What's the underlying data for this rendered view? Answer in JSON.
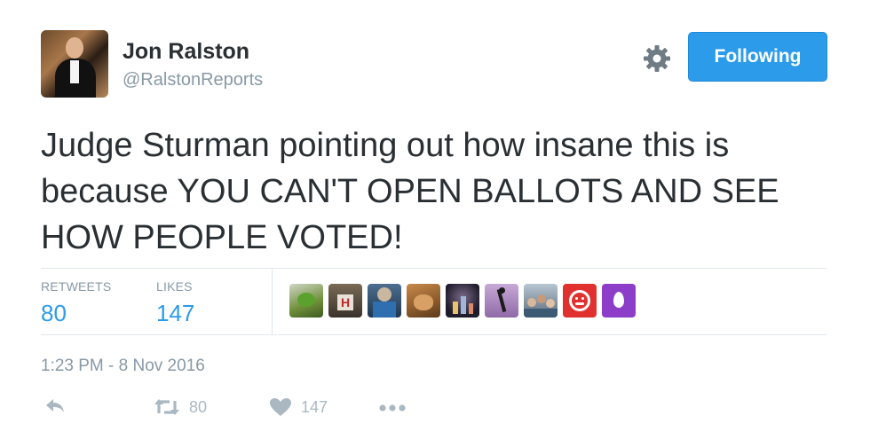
{
  "author": {
    "name": "Jon Ralston",
    "handle": "@RalstonReports"
  },
  "follow_button": {
    "label": "Following",
    "color": "#2b9bea"
  },
  "tweet": {
    "text": "Judge Sturman pointing out how insane this is because YOU CAN'T OPEN BALLOTS AND SEE HOW PEOPLE VOTED!",
    "timestamp": "1:23 PM - 8 Nov 2016"
  },
  "stats": {
    "retweets_label": "RETWEETS",
    "retweets_value": "80",
    "likes_label": "LIKES",
    "likes_value": "147"
  },
  "liker_avatars": [
    "frog-avatar",
    "letter-h-avatar",
    "football-player-avatar",
    "dog-avatar",
    "city-night-avatar",
    "dancer-avatar",
    "group-photo-avatar",
    "red-face-avatar",
    "purple-egg-avatar"
  ],
  "actions": {
    "reply_icon": "reply-icon",
    "retweet_icon": "retweet-icon",
    "retweet_count": "80",
    "like_icon": "heart-icon",
    "like_count": "147",
    "more_icon": "more-dots-icon"
  },
  "colors": {
    "accent": "#2b9bea",
    "muted": "#8899a6",
    "icon": "#aab8c2",
    "text": "#292f33"
  }
}
